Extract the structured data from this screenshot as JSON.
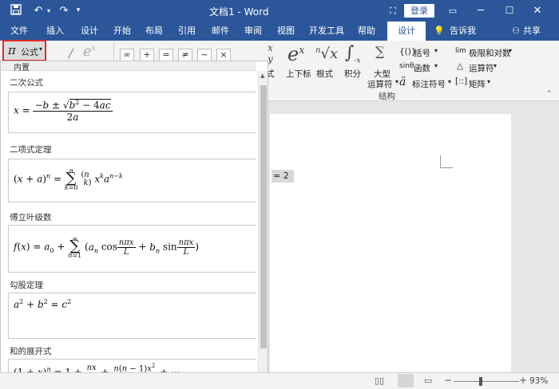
{
  "title_bar": {
    "doc_title": "文档1 - Word",
    "login_label": "登录",
    "undo_icon": "undo-icon",
    "redo_icon": "redo-icon"
  },
  "tabs": [
    "文件",
    "插入",
    "设计",
    "开始",
    "布局",
    "引用",
    "邮件",
    "审阅",
    "视图",
    "开发工具",
    "帮助"
  ],
  "active_tab": "设计",
  "tell_me": "告诉我",
  "share": "共享",
  "equation_button": {
    "symbol": "π",
    "label": "公式"
  },
  "ribbon": {
    "fraction_suffix": "式",
    "script": "上下标",
    "radical": "根式",
    "integral": "积分",
    "large_operator_1": "大型",
    "large_operator_2": "运算符",
    "bracket": "括号",
    "function": "函数",
    "accent": "标注符号",
    "limit_log": "极限和对数",
    "operator": "运算符",
    "matrix": "矩阵",
    "group_label": "结构"
  },
  "gallery": {
    "header": "内置",
    "categories": [
      {
        "label": "二次公式"
      },
      {
        "label": "二项式定理"
      },
      {
        "label": "傅立叶级数"
      },
      {
        "label": "勾股定理"
      },
      {
        "label": "和的展开式"
      }
    ]
  },
  "document": {
    "inline_equation": "= 2"
  },
  "status_bar": {
    "zoom": "93%"
  }
}
